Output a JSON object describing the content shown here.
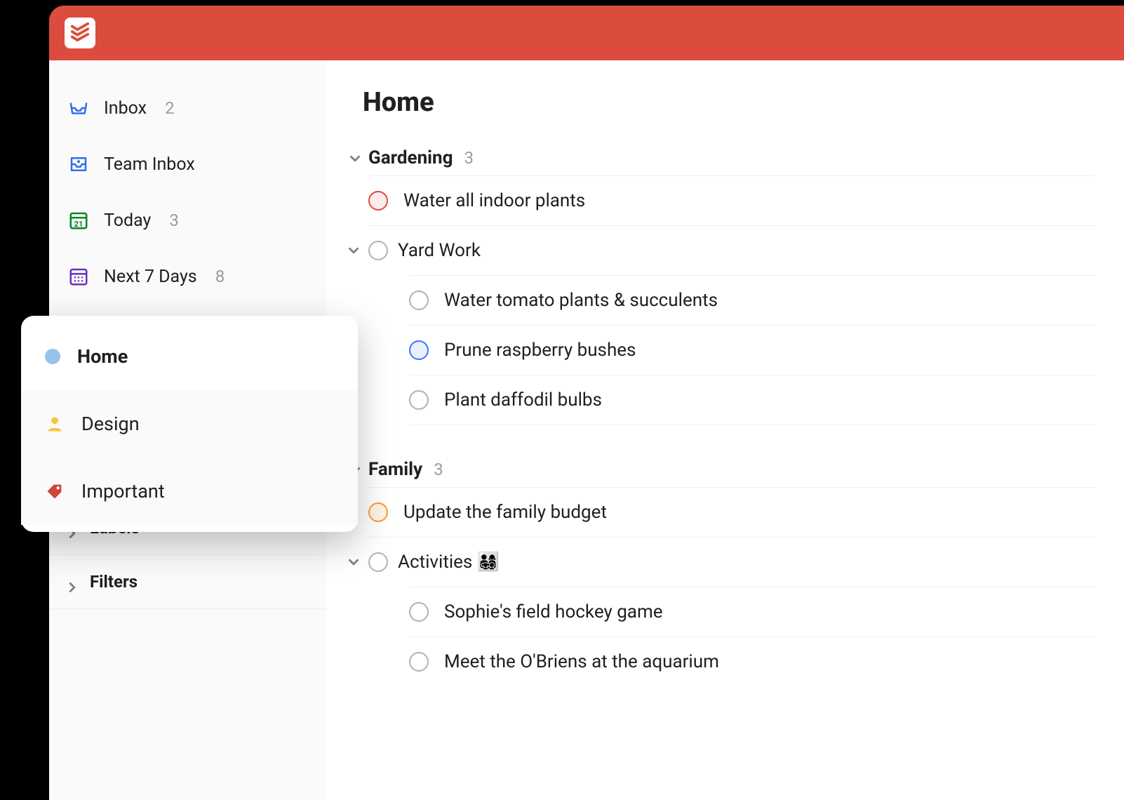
{
  "colors": {
    "brand": "#db4c3f",
    "priority_red": "#dc4c3e",
    "priority_blue": "#4073ff",
    "priority_orange": "#ff9933",
    "favorite_dot": "#96c3eb",
    "person_yellow": "#f6c343",
    "tag_red": "#d1453b"
  },
  "sidebar": {
    "items": [
      {
        "label": "Inbox",
        "count": "2"
      },
      {
        "label": "Team Inbox",
        "count": ""
      },
      {
        "label": "Today",
        "count": "3"
      },
      {
        "label": "Next 7 Days",
        "count": "8"
      }
    ],
    "groups": [
      {
        "label": "Labels"
      },
      {
        "label": "Filters"
      }
    ]
  },
  "popover": {
    "items": [
      {
        "label": "Home"
      },
      {
        "label": "Design"
      },
      {
        "label": "Important"
      }
    ]
  },
  "main": {
    "title": "Home",
    "sections": [
      {
        "title": "Gardening",
        "count": "3",
        "tasks": [
          {
            "label": "Water all indoor plants",
            "priority": "red"
          }
        ],
        "subgroup": {
          "label": "Yard Work",
          "tasks": [
            {
              "label": "Water tomato plants & succulents",
              "priority": ""
            },
            {
              "label": "Prune raspberry bushes",
              "priority": "blue"
            },
            {
              "label": "Plant daffodil bulbs",
              "priority": ""
            }
          ]
        }
      },
      {
        "title": "Family",
        "count": "3",
        "tasks": [
          {
            "label": "Update the family budget",
            "priority": "orange"
          }
        ],
        "subgroup": {
          "label": "Activities 👨‍👩‍👧‍👦",
          "tasks": [
            {
              "label": "Sophie's field hockey game",
              "priority": ""
            },
            {
              "label": "Meet the O'Briens at the aquarium",
              "priority": ""
            }
          ]
        }
      }
    ]
  }
}
